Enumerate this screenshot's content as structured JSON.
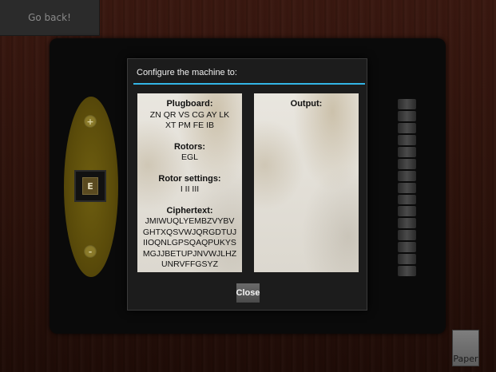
{
  "header": {
    "back_label": "Go back!"
  },
  "machine": {
    "rotor_plus": "+",
    "rotor_minus": "-",
    "rotor_letter": "E",
    "paper_label": "Paper"
  },
  "dialog": {
    "title": "Configure the machine to:",
    "plugboard_label": "Plugboard:",
    "plugboard_value": "ZN QR VS CG AY LK\nXT PM FE IB",
    "rotors_label": "Rotors:",
    "rotors_value": "EGL",
    "rotor_settings_label": "Rotor settings:",
    "rotor_settings_value": "I II III",
    "ciphertext_label": "Ciphertext:",
    "ciphertext_value": "JMIWUQLYEMBZVYBVGHTXQSVWJQRGDTUJIIOQNLGPSQAQPUKYSMGJJBETUPJNVWJLHZUNRVFFGSYZ",
    "output_label": "Output:",
    "close_label": "Close"
  },
  "colors": {
    "accent": "#33b5e5",
    "rotor_oval": "#5a4b0a"
  }
}
